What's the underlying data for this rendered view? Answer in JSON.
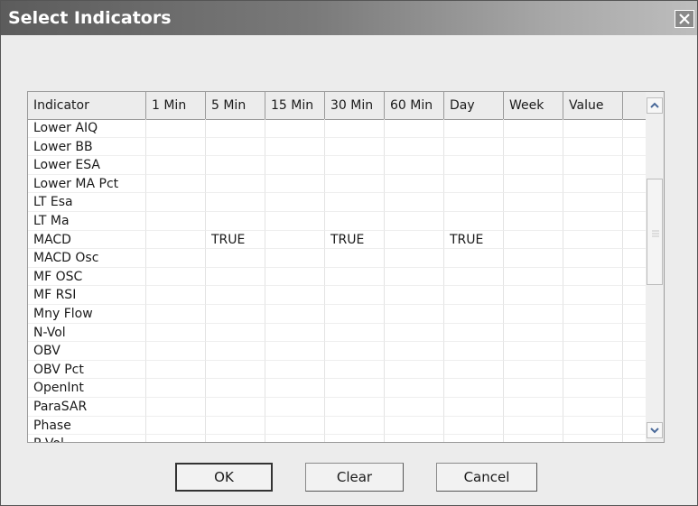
{
  "window": {
    "title": "Select Indicators"
  },
  "grid": {
    "columns": [
      "Indicator",
      "1 Min",
      "5 Min",
      "15 Min",
      "30 Min",
      "60 Min",
      "Day",
      "Week",
      "Value",
      ""
    ],
    "rows": [
      [
        "Lower AIQ",
        "",
        "",
        "",
        "",
        "",
        "",
        "",
        "",
        ""
      ],
      [
        "Lower BB",
        "",
        "",
        "",
        "",
        "",
        "",
        "",
        "",
        ""
      ],
      [
        "Lower ESA",
        "",
        "",
        "",
        "",
        "",
        "",
        "",
        "",
        ""
      ],
      [
        "Lower MA Pct",
        "",
        "",
        "",
        "",
        "",
        "",
        "",
        "",
        ""
      ],
      [
        "LT Esa",
        "",
        "",
        "",
        "",
        "",
        "",
        "",
        "",
        ""
      ],
      [
        "LT Ma",
        "",
        "",
        "",
        "",
        "",
        "",
        "",
        "",
        ""
      ],
      [
        "MACD",
        "",
        "TRUE",
        "",
        "TRUE",
        "",
        "TRUE",
        "",
        "",
        ""
      ],
      [
        "MACD Osc",
        "",
        "",
        "",
        "",
        "",
        "",
        "",
        "",
        ""
      ],
      [
        "MF OSC",
        "",
        "",
        "",
        "",
        "",
        "",
        "",
        "",
        ""
      ],
      [
        "MF RSI",
        "",
        "",
        "",
        "",
        "",
        "",
        "",
        "",
        ""
      ],
      [
        "Mny Flow",
        "",
        "",
        "",
        "",
        "",
        "",
        "",
        "",
        ""
      ],
      [
        "N-Vol",
        "",
        "",
        "",
        "",
        "",
        "",
        "",
        "",
        ""
      ],
      [
        "OBV",
        "",
        "",
        "",
        "",
        "",
        "",
        "",
        "",
        ""
      ],
      [
        "OBV Pct",
        "",
        "",
        "",
        "",
        "",
        "",
        "",
        "",
        ""
      ],
      [
        "OpenInt",
        "",
        "",
        "",
        "",
        "",
        "",
        "",
        "",
        ""
      ],
      [
        "ParaSAR",
        "",
        "",
        "",
        "",
        "",
        "",
        "",
        "",
        ""
      ],
      [
        "Phase",
        "",
        "",
        "",
        "",
        "",
        "",
        "",
        "",
        ""
      ],
      [
        "P Vol",
        "",
        "",
        "",
        "",
        "",
        "",
        "",
        "",
        ""
      ]
    ]
  },
  "buttons": {
    "ok": "OK",
    "clear": "Clear",
    "cancel": "Cancel"
  },
  "icons": {
    "close": "close-icon",
    "scroll_up": "arrow-up-icon",
    "scroll_down": "arrow-down-icon",
    "grip": "grip-icon"
  }
}
